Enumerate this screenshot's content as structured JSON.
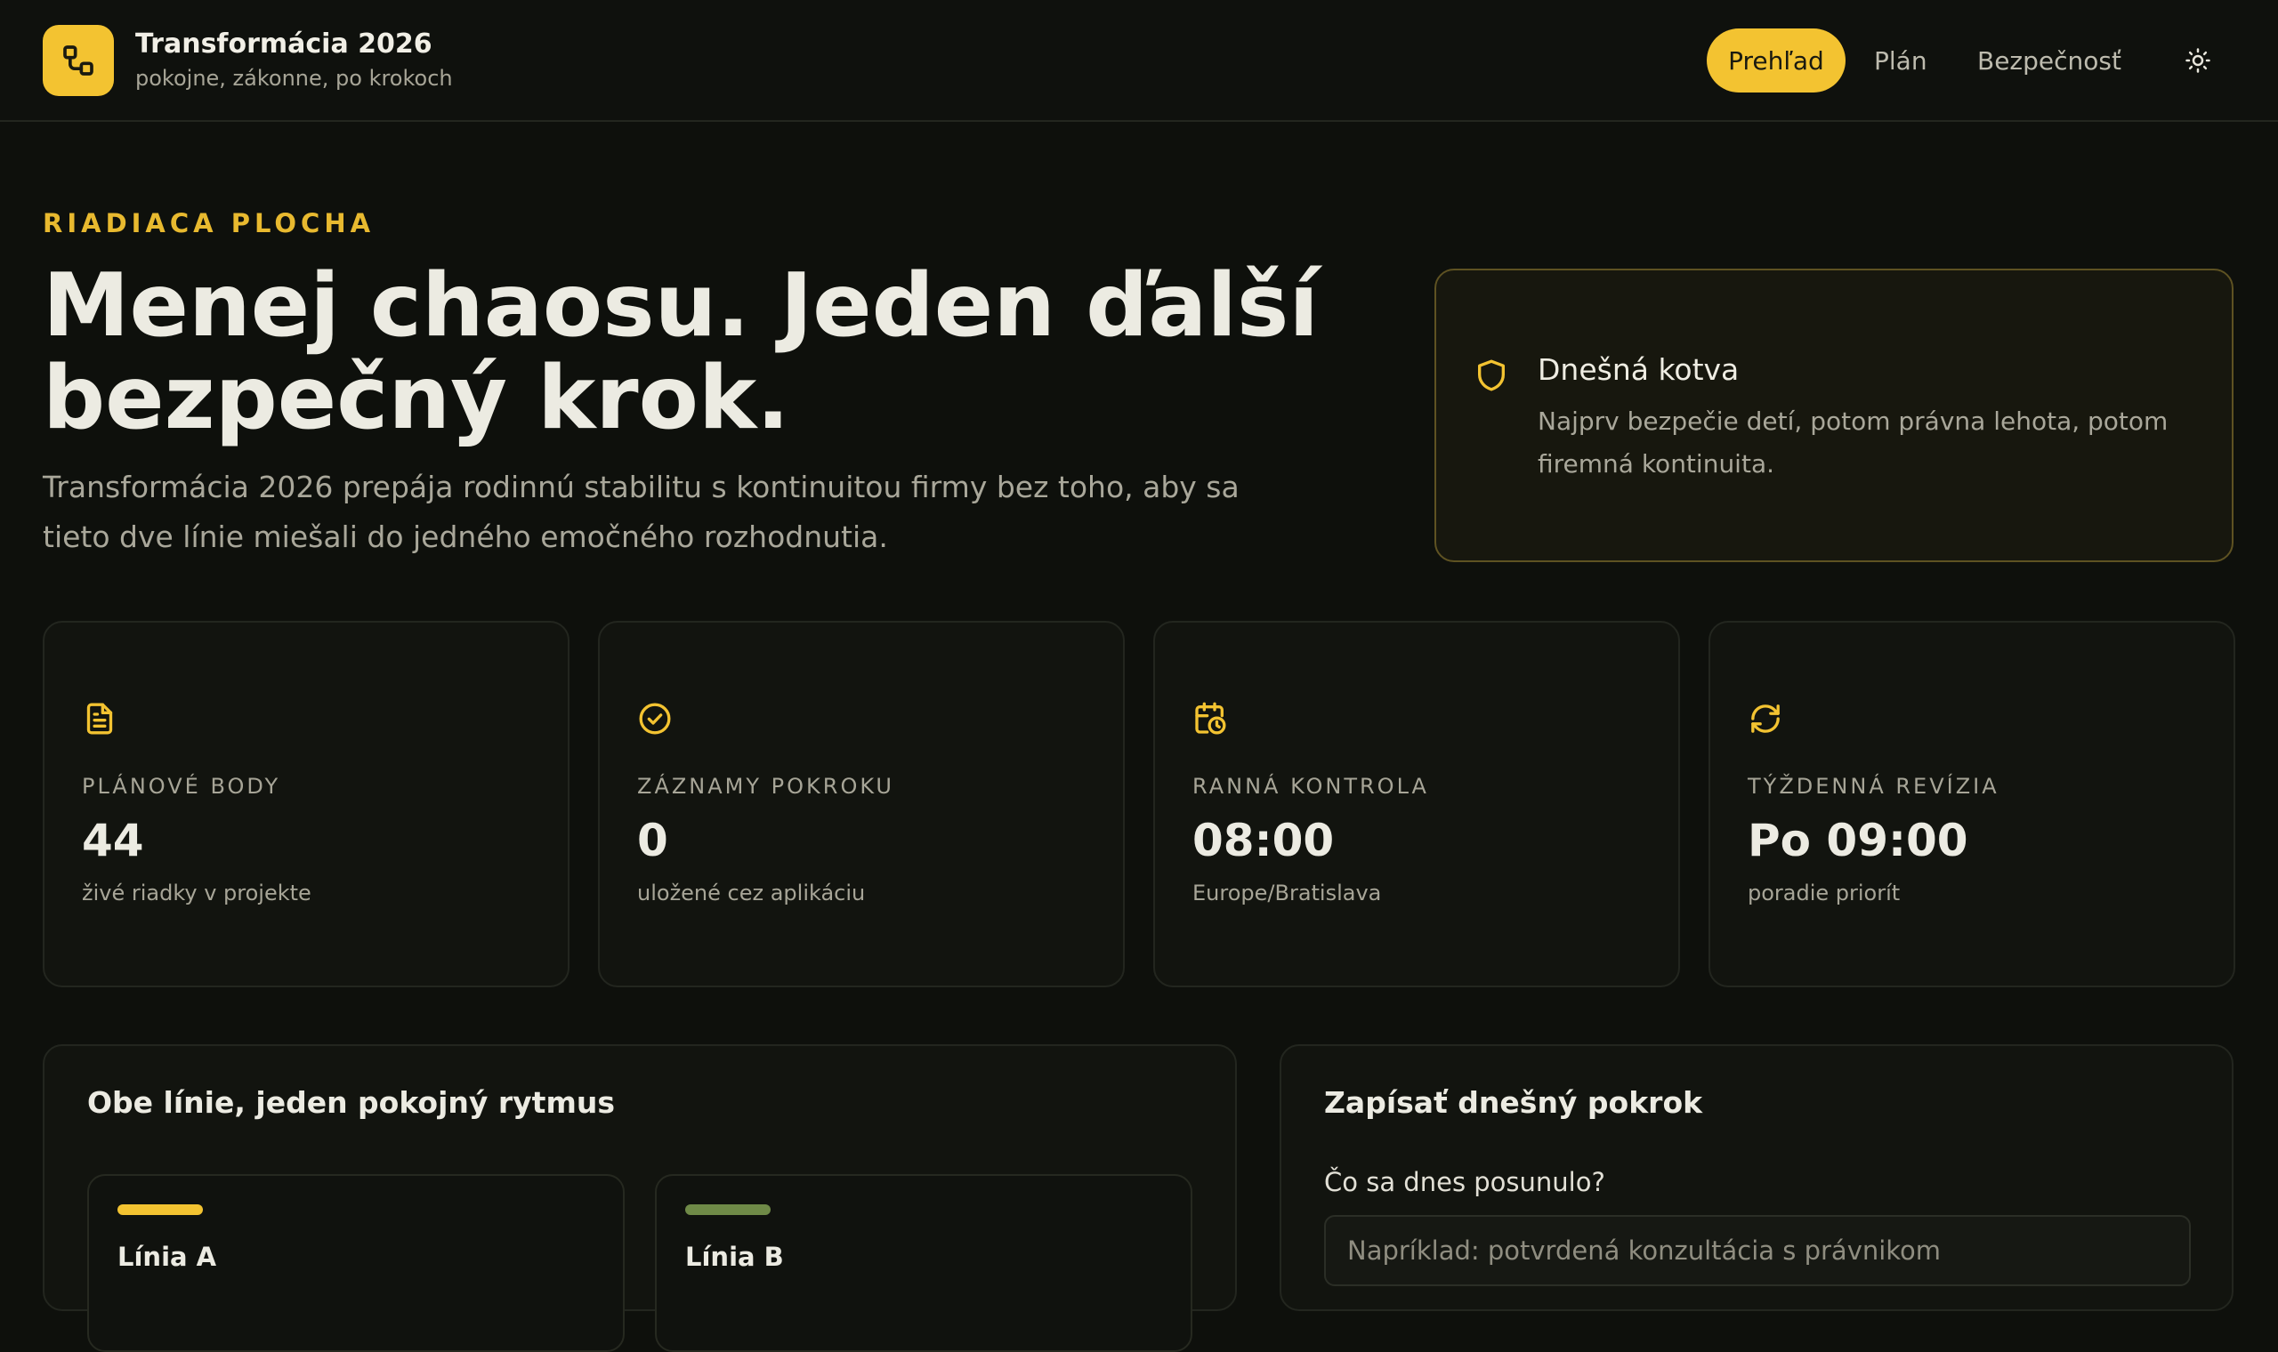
{
  "colors": {
    "accent": "#f3c331",
    "line_a": "#f3c331",
    "line_b": "#6f8a47",
    "background": "#0e100c"
  },
  "header": {
    "title": "Transformácia 2026",
    "subtitle": "pokojne, zákonne, po krokoch",
    "logo_icon": "link-squares-icon",
    "nav": [
      {
        "label": "Prehľad",
        "active": true
      },
      {
        "label": "Plán",
        "active": false
      },
      {
        "label": "Bezpečnosť",
        "active": false
      }
    ],
    "theme_icon": "sun-icon"
  },
  "hero": {
    "eyebrow": "RIADIACA PLOCHA",
    "title": "Menej chaosu. Jeden ďalší bezpečný krok.",
    "description": "Transformácia 2026 prepája rodinnú stabilitu s kontinuitou firmy bez toho, aby sa tieto dve línie miešali do jedného emočného rozhodnutia."
  },
  "anchor": {
    "icon": "shield-icon",
    "title": "Dnešná kotva",
    "text": "Najprv bezpečie detí, potom právna lehota, potom firemná kontinuita."
  },
  "stats": [
    {
      "icon": "document-icon",
      "label": "PLÁNOVÉ BODY",
      "value": "44",
      "sub": "živé riadky v projekte"
    },
    {
      "icon": "check-circle-icon",
      "label": "ZÁZNAMY POKROKU",
      "value": "0",
      "sub": "uložené cez aplikáciu"
    },
    {
      "icon": "calendar-clock-icon",
      "label": "RANNÁ KONTROLA",
      "value": "08:00",
      "sub": "Europe/Bratislava"
    },
    {
      "icon": "refresh-icon",
      "label": "TÝŽDENNÁ REVÍZIA",
      "value": "Po 09:00",
      "sub": "poradie priorít"
    }
  ],
  "lines_panel": {
    "title": "Obe línie, jeden pokojný rytmus",
    "lines": [
      {
        "title": "Línia A"
      },
      {
        "title": "Línia B"
      }
    ]
  },
  "progress_panel": {
    "title": "Zapísať dnešný pokrok",
    "field_label": "Čo sa dnes posunulo?",
    "placeholder": "Napríklad: potvrdená konzultácia s právnikom"
  }
}
